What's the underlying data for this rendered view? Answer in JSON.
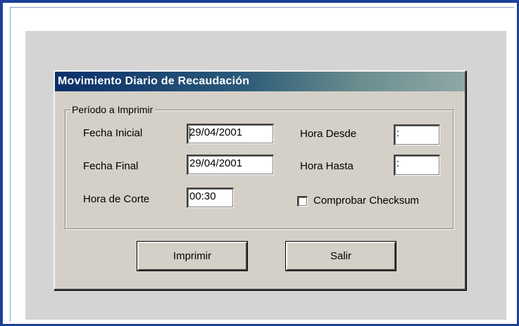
{
  "dialog": {
    "title": "Movimiento Diario de Recaudación"
  },
  "group": {
    "legend": "Período a Imprimir"
  },
  "fields": {
    "fecha_inicial": {
      "label": "Fecha Inicial",
      "value": "29/04/2001"
    },
    "fecha_final": {
      "label": "Fecha Final",
      "value": "29/04/2001"
    },
    "hora_corte": {
      "label": "Hora de Corte",
      "value": "00:30"
    },
    "hora_desde": {
      "label": "Hora Desde",
      "value": ":"
    },
    "hora_hasta": {
      "label": "Hora Hasta",
      "value": ":"
    }
  },
  "checksum": {
    "label": "Comprobar Checksum",
    "checked": false
  },
  "buttons": {
    "print_label": "Imprimir",
    "exit_label": "Salir"
  },
  "colors": {
    "frame_border": "#1c3f97",
    "titlebar_start": "#0a2f6a",
    "titlebar_end": "#8fa8a6",
    "dialog_face": "#d4d0c8"
  }
}
